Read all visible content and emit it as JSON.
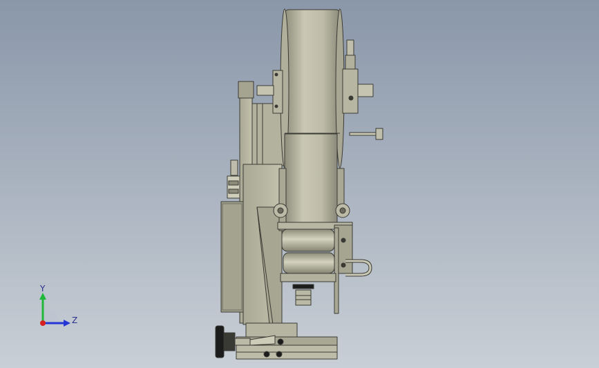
{
  "viewport": {
    "background_top": "#8a97a9",
    "background_bottom": "#c9cfd6"
  },
  "triad": {
    "y_label": "Y",
    "z_label": "Z",
    "y_color": "#1fb83a",
    "z_color": "#2436d6",
    "x_color": "#d62020"
  },
  "model": {
    "part_color": "#b9b8a4",
    "part_shadow": "#8f8e7c",
    "edge_color": "#3a3a34",
    "dark_part": "#1c1c1c"
  }
}
